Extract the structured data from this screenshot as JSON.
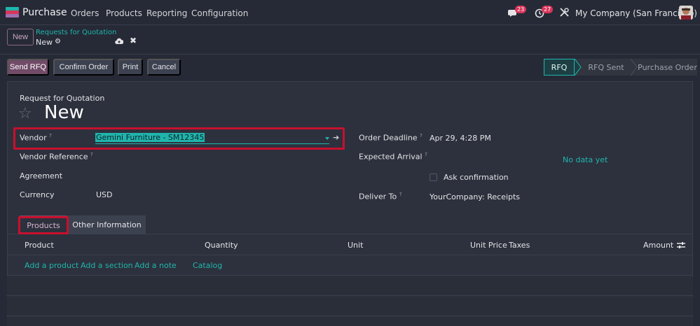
{
  "navbar": {
    "app_name": "Purchase",
    "menu": [
      "Orders",
      "Products",
      "Reporting",
      "Configuration"
    ],
    "messages_count": "23",
    "activities_count": "27",
    "company": "My Company (San Francisco)"
  },
  "control": {
    "new_label": "New",
    "breadcrumb_parent": "Requests for Quotation",
    "breadcrumb_current": "New"
  },
  "actions": {
    "send_rfq": "Send RFQ",
    "confirm_order": "Confirm Order",
    "print": "Print",
    "cancel": "Cancel"
  },
  "status": {
    "stages": [
      "RFQ",
      "RFQ Sent",
      "Purchase Order"
    ],
    "current": "RFQ"
  },
  "form": {
    "subtitle": "Request for Quotation",
    "title": "New",
    "vendor_label": "Vendor",
    "vendor_value": "Gemini Furniture - SM12345",
    "vendor_reference_label": "Vendor Reference",
    "agreement_label": "Agreement",
    "currency_label": "Currency",
    "currency_value": "USD",
    "order_deadline_label": "Order Deadline",
    "order_deadline_value": "Apr 29, 4:28 PM",
    "expected_arrival_label": "Expected Arrival",
    "expected_arrival_value": "No data yet",
    "ask_confirmation_label": "Ask confirmation",
    "deliver_to_label": "Deliver To",
    "deliver_to_value": "YourCompany: Receipts",
    "help_mark": "?"
  },
  "tabs": {
    "products": "Products",
    "other_info": "Other Information"
  },
  "table": {
    "headers": {
      "product": "Product",
      "quantity": "Quantity",
      "unit": "Unit",
      "unit_price": "Unit Price",
      "taxes": "Taxes",
      "amount": "Amount"
    },
    "add_product": "Add a product",
    "add_section": "Add a section",
    "add_note": "Add a note",
    "catalog": "Catalog"
  },
  "colors": {
    "brand": "#714b67",
    "accent": "#1fb5ac",
    "highlight": "#c8102e",
    "background": "#262a36"
  },
  "icons": [
    "discuss-icon",
    "activity-clock-icon",
    "tools-icon",
    "gear-icon",
    "cloud-upload-icon",
    "close-icon",
    "star-icon",
    "arrow-right-icon",
    "settings-sliders-icon"
  ]
}
